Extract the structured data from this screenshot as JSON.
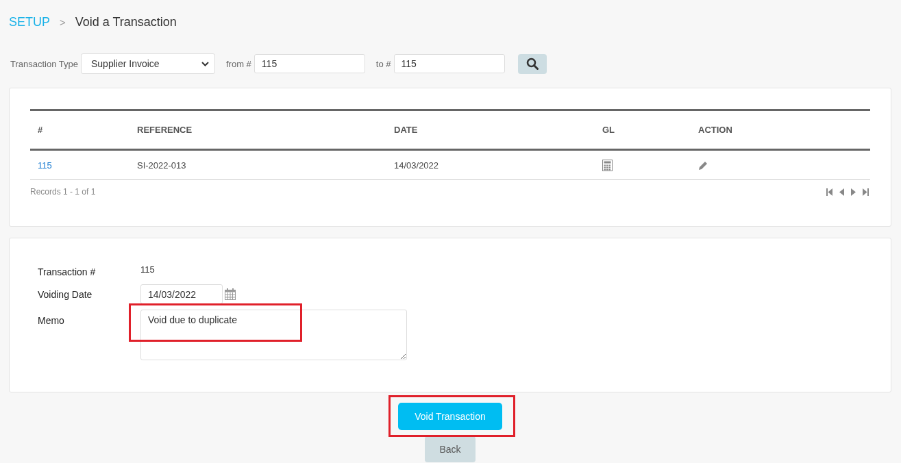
{
  "breadcrumb": {
    "parent": "SETUP",
    "separator": ">",
    "current": "Void a Transaction"
  },
  "filter": {
    "type_label": "Transaction Type",
    "type_value": "Supplier Invoice",
    "from_label": "from #",
    "from_value": "115",
    "to_label": "to #",
    "to_value": "115"
  },
  "table": {
    "columns": [
      "#",
      "REFERENCE",
      "DATE",
      "GL",
      "ACTION"
    ],
    "rows": [
      {
        "number": "115",
        "reference": "SI-2022-013",
        "date": "14/03/2022"
      }
    ],
    "records": "Records 1 - 1 of 1"
  },
  "form": {
    "transaction_label": "Transaction #",
    "transaction_value": "115",
    "date_label": "Voiding Date",
    "date_value": "14/03/2022",
    "memo_label": "Memo",
    "memo_value": "Void due to duplicate",
    "memo_highlighted": true
  },
  "buttons": {
    "void": "Void Transaction",
    "void_highlighted": true,
    "back": "Back"
  }
}
